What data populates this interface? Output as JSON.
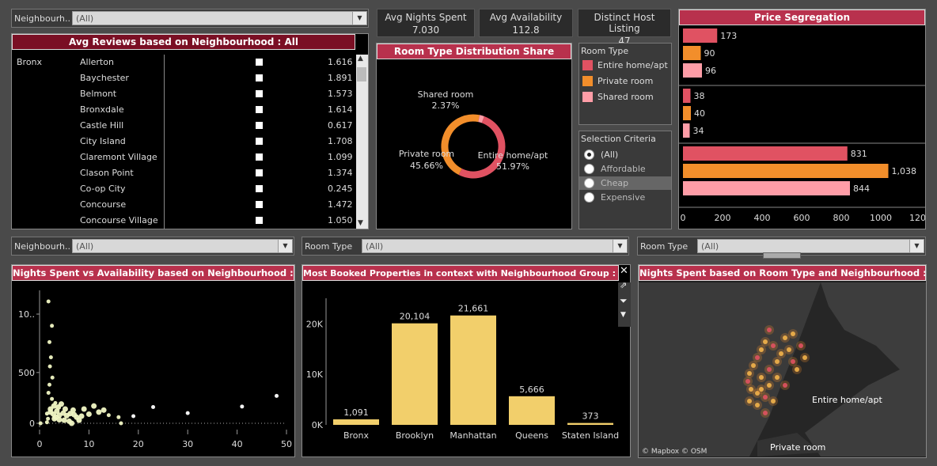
{
  "filters": {
    "top_neighbourhood": {
      "label": "Neighbourh..",
      "value": "(All)"
    },
    "mid_neighbourhood": {
      "label": "Neighbourh..",
      "value": "(All)"
    },
    "mid_room_type": {
      "label": "Room Type",
      "value": "(All)"
    },
    "right_room_type": {
      "label": "Room Type",
      "value": "(All)"
    }
  },
  "kpis": [
    {
      "label": "Avg Nights Spent",
      "value": "7.030"
    },
    {
      "label": "Avg Availability",
      "value": "112.8"
    },
    {
      "label": "Distinct Host Listing",
      "value": "47"
    }
  ],
  "reviews": {
    "title": "Avg Reviews based on Neighbourhood : All",
    "group": "Bronx",
    "rows": [
      {
        "name": "Allerton",
        "value": "1.616"
      },
      {
        "name": "Baychester",
        "value": "1.891"
      },
      {
        "name": "Belmont",
        "value": "1.573"
      },
      {
        "name": "Bronxdale",
        "value": "1.614"
      },
      {
        "name": "Castle Hill",
        "value": "0.617"
      },
      {
        "name": "City Island",
        "value": "1.708"
      },
      {
        "name": "Claremont Village",
        "value": "1.099"
      },
      {
        "name": "Clason Point",
        "value": "1.374"
      },
      {
        "name": "Co-op City",
        "value": "0.245"
      },
      {
        "name": "Concourse",
        "value": "1.472"
      },
      {
        "name": "Concourse Village",
        "value": "1.050"
      }
    ]
  },
  "room_share": {
    "title": "Room Type Distribution Share",
    "labels": [
      {
        "name": "Shared room",
        "pct": "2.37%"
      },
      {
        "name": "Private room",
        "pct": "45.66%"
      },
      {
        "name": "Entire home/apt",
        "pct": "51.97%"
      }
    ]
  },
  "room_legend": {
    "title": "Room Type",
    "items": [
      {
        "name": "Entire home/apt",
        "color": "#e05262"
      },
      {
        "name": "Private room",
        "color": "#f28e2b"
      },
      {
        "name": "Shared room",
        "color": "#ff9da7"
      }
    ]
  },
  "selection": {
    "title": "Selection Criteria",
    "options": [
      "(All)",
      "Affordable",
      "Cheap",
      "Expensive"
    ],
    "selected": "(All)"
  },
  "price_seg": {
    "title": "Price Segregation"
  },
  "scatter": {
    "title": "Nights Spent vs Availability based on Neighbourhood : All"
  },
  "booked": {
    "title": "Most Booked Properties in context with Neighbourhood Group : All"
  },
  "map": {
    "title": "Nights Spent based on Room Type and Neighbourhood : All",
    "label_entire": "Entire home/apt",
    "label_private": "Private room",
    "attribution": "© Mapbox © OSM"
  },
  "chart_data": [
    {
      "type": "pie",
      "categories": [
        "Entire home/apt",
        "Private room",
        "Shared room"
      ],
      "values": [
        51.97,
        45.66,
        2.37
      ],
      "colors": [
        "#e05262",
        "#f28e2b",
        "#ff9da7"
      ],
      "title": "Room Type Distribution Share"
    },
    {
      "type": "bar",
      "title": "Price Segregation",
      "orientation": "horizontal",
      "groups": [
        {
          "values": [
            173,
            90,
            96
          ]
        },
        {
          "values": [
            38,
            40,
            34
          ]
        },
        {
          "values": [
            831,
            1038,
            844
          ]
        }
      ],
      "labels": [
        [
          "173",
          "90",
          "96"
        ],
        [
          "38",
          "40",
          "34"
        ],
        [
          "831",
          "1,038",
          "844"
        ]
      ],
      "series_colors": [
        "#e05262",
        "#f28e2b",
        "#ff9da7"
      ],
      "xlim": [
        0,
        1200
      ],
      "xticks": [
        "0",
        "200",
        "400",
        "600",
        "800",
        "1000",
        "1200"
      ]
    },
    {
      "type": "scatter",
      "title": "Nights Spent vs Availability based on Neighbourhood : All",
      "xlim": [
        0,
        50
      ],
      "xticks": [
        "0",
        "10",
        "20",
        "30",
        "40",
        "50"
      ],
      "yticks": [
        "0",
        "500",
        "10.."
      ],
      "points": [
        [
          1.5,
          95
        ],
        [
          2.2,
          110
        ],
        [
          2.8,
          90
        ],
        [
          3.5,
          120
        ],
        [
          4.0,
          80
        ],
        [
          4.8,
          100
        ],
        [
          5.5,
          75
        ],
        [
          6.2,
          95
        ],
        [
          7.0,
          85
        ],
        [
          8.5,
          70
        ],
        [
          10,
          90
        ],
        [
          12,
          110
        ],
        [
          14,
          80
        ],
        [
          16,
          60
        ],
        [
          19,
          70
        ],
        [
          23,
          160
        ],
        [
          30,
          100
        ],
        [
          41,
          165
        ],
        [
          48,
          270
        ],
        [
          1.8,
          300
        ],
        [
          2.5,
          240
        ],
        [
          3.2,
          200
        ],
        [
          2.0,
          380
        ],
        [
          2.6,
          450
        ],
        [
          2.1,
          560
        ],
        [
          2.3,
          650
        ],
        [
          2.0,
          800
        ],
        [
          2.5,
          960
        ],
        [
          1.8,
          1200
        ],
        [
          1.5,
          10
        ],
        [
          1.7,
          45
        ],
        [
          3.0,
          45
        ],
        [
          4.0,
          35
        ],
        [
          5.0,
          30
        ],
        [
          6.0,
          20
        ],
        [
          8,
          30
        ],
        [
          11,
          170
        ],
        [
          13,
          130
        ],
        [
          9,
          140
        ],
        [
          16.5,
          0
        ],
        [
          0.2,
          0
        ],
        [
          6.5,
          0
        ],
        [
          7.5,
          60
        ],
        [
          2.2,
          140
        ],
        [
          3.8,
          160
        ],
        [
          5.2,
          140
        ],
        [
          6.8,
          130
        ],
        [
          2.9,
          170
        ],
        [
          4.4,
          190
        ],
        [
          3.3,
          60
        ]
      ]
    },
    {
      "type": "bar",
      "title": "Most Booked Properties in context with Neighbourhood Group : All",
      "categories": [
        "Bronx",
        "Brooklyn",
        "Manhattan",
        "Queens",
        "Staten Island"
      ],
      "values": [
        1091,
        20104,
        21661,
        5666,
        373
      ],
      "value_labels": [
        "1,091",
        "20,104",
        "21,661",
        "5,666",
        "373"
      ],
      "yticks": [
        "0K",
        "10K",
        "20K"
      ],
      "ylim": [
        0,
        23500
      ],
      "color": "#f2cf6b"
    }
  ]
}
